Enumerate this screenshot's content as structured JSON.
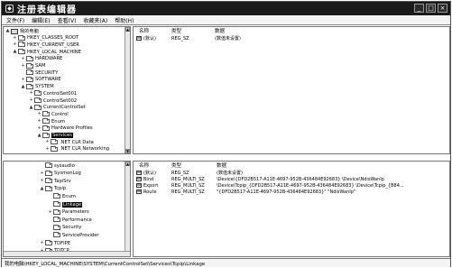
{
  "window": {
    "title": "注册表编辑器",
    "app_icon": "registry-icon",
    "buttons": [
      "_",
      "□",
      "×"
    ]
  },
  "menu": [
    "文件(F)",
    "编辑(E)",
    "查看(V)",
    "收藏夹(A)",
    "帮助(H)"
  ],
  "top": {
    "tree": [
      {
        "label": "我的电脑",
        "exp": "▲",
        "icon": "computer"
      },
      {
        "label": "HKEY_CLASSES_ROOT",
        "exp": "+",
        "icon": "folder"
      },
      {
        "label": "HKEY_CURRENT_USER",
        "exp": "+",
        "icon": "folder"
      },
      {
        "label": "HKEY_LOCAL_MACHINE",
        "exp": "▲",
        "icon": "folder"
      },
      {
        "label": "HARDWARE",
        "exp": "+",
        "icon": "folder"
      },
      {
        "label": "SAM",
        "exp": "+",
        "icon": "folder"
      },
      {
        "label": "SECURITY",
        "exp": "",
        "icon": "folder"
      },
      {
        "label": "SOFTWARE",
        "exp": "+",
        "icon": "folder"
      },
      {
        "label": "SYSTEM",
        "exp": "▲",
        "icon": "folder"
      },
      {
        "label": "ControlSet001",
        "exp": "+",
        "icon": "folder"
      },
      {
        "label": "ControlSet002",
        "exp": "+",
        "icon": "folder"
      },
      {
        "label": "CurrentControlSet",
        "exp": "▲",
        "icon": "folder"
      },
      {
        "label": "Control",
        "exp": "+",
        "icon": "folder"
      },
      {
        "label": "Enum",
        "exp": "+",
        "icon": "folder"
      },
      {
        "label": "Hardware Profiles",
        "exp": "+",
        "icon": "folder"
      },
      {
        "label": "Services",
        "exp": "▲",
        "icon": "folder",
        "selected": true
      },
      {
        "label": ".NET CLR Data",
        "exp": "+",
        "icon": "folder"
      },
      {
        "label": ".NET CLR Networking",
        "exp": "+",
        "icon": "folder"
      }
    ],
    "columns": [
      "名称",
      "类型",
      "数据"
    ],
    "values": [
      {
        "name": "(默认)",
        "type": "REG_SZ",
        "data": "(数值未设置)",
        "icon": "ab"
      }
    ]
  },
  "bottom": {
    "tree": [
      {
        "label": "sysaudio",
        "exp": "",
        "icon": "folder"
      },
      {
        "label": "SysmonLog",
        "exp": "+",
        "icon": "folder"
      },
      {
        "label": "TapiSrv",
        "exp": "+",
        "icon": "folder"
      },
      {
        "label": "Tcpip",
        "exp": "▲",
        "icon": "folder"
      },
      {
        "label": "Enum",
        "exp": "",
        "icon": "folder"
      },
      {
        "label": "Linkage",
        "exp": "",
        "icon": "folder",
        "selected": true
      },
      {
        "label": "Parameters",
        "exp": "+",
        "icon": "folder"
      },
      {
        "label": "Performance",
        "exp": "",
        "icon": "folder"
      },
      {
        "label": "Security",
        "exp": "",
        "icon": "folder"
      },
      {
        "label": "ServiceProvider",
        "exp": "",
        "icon": "folder"
      },
      {
        "label": "TDFIPE",
        "exp": "+",
        "icon": "folder"
      },
      {
        "label": "TDTCP",
        "exp": "+",
        "icon": "folder"
      }
    ],
    "columns": [
      "名称",
      "类型",
      "数据"
    ],
    "values": [
      {
        "name": "(默认)",
        "type": "REG_SZ",
        "data": "(数值未设置)",
        "icon": "ab"
      },
      {
        "name": "Bind",
        "type": "REG_MULTI_SZ",
        "data": "\\Device\\{DFD2B517-A11E-4697-952B-436484E92683} \\Device\\NdisWanIp",
        "icon": "ab"
      },
      {
        "name": "Export",
        "type": "REG_MULTI_SZ",
        "data": "\\Device\\Tcpip_{DFD2B517-A11E-4697-952B-436484E92683} \\Device\\Tcpip_{B84...",
        "icon": "ab"
      },
      {
        "name": "Route",
        "type": "REG_MULTI_SZ",
        "data": "\"{DFD2B517-A11E-4697-952B-436484E92683}\" \"NdisWanIp\"",
        "icon": "ab"
      }
    ]
  },
  "status": "我的电脑\\HKEY_LOCAL_MACHINE\\SYSTEM\\CurrentControlSet\\Services\\Tcpip\\Linkage"
}
